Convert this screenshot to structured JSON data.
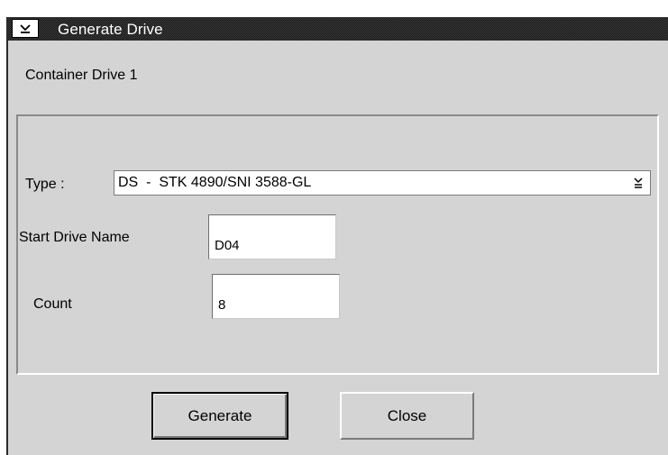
{
  "window": {
    "title": "Generate Drive",
    "menu_icon": "chevron-down-icon"
  },
  "header": {
    "container_label": "Container Drive 1"
  },
  "form": {
    "type_label": "Type :",
    "type_value": "DS  -  STK 4890/SNI 3588-GL",
    "start_drive_label": "Start Drive Name",
    "start_drive_value": "D04",
    "count_label": "Count",
    "count_value": "8"
  },
  "buttons": {
    "generate_label": "Generate",
    "close_label": "Close"
  }
}
